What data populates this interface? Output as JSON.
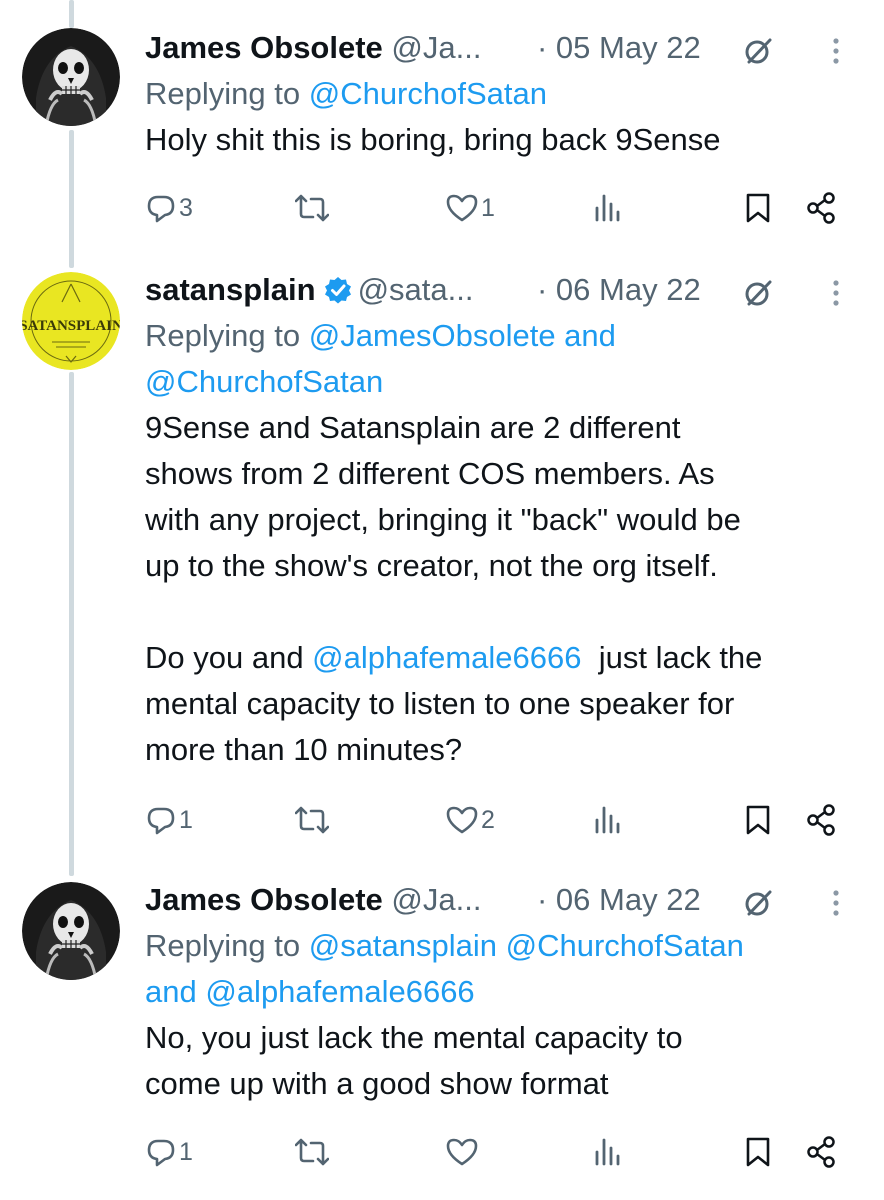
{
  "tweets": [
    {
      "name": "James Obsolete",
      "handle": "@Ja...",
      "date": "· 05 May 22",
      "reply_prefix": "Replying to ",
      "reply_links": [
        "@ChurchofSatan"
      ],
      "text": "Holy shit this is boring, bring back 9Sense",
      "replies": "3",
      "retweets": "",
      "likes": "1",
      "avatar": "skull-avatar"
    },
    {
      "name": "satansplain",
      "handle": "@sata...",
      "date": "· 06 May 22",
      "verified": true,
      "reply_prefix": "Replying to ",
      "reply_line1": "@JamesObsolete and",
      "reply_line2": "@ChurchofSatan",
      "text_p1": "9Sense and Satansplain are 2 different\nshows from 2 different COS members. As\nwith any project, bringing it \"back\" would be\nup to the show's creator, not the org itself.",
      "text_p2_a": "Do you and ",
      "text_p2_mention": "@alphafemale6666",
      "text_p2_b": "  just lack the",
      "text_p2_rest": "mental capacity to listen to one speaker for\nmore than 10 minutes?",
      "replies": "1",
      "retweets": "",
      "likes": "2",
      "avatar": "satansplain-logo",
      "avatar_text": "SATANSPLAIN"
    },
    {
      "name": "James Obsolete",
      "handle": "@Ja...",
      "date": "· 06 May 22",
      "reply_prefix": "Replying to ",
      "reply_line1": "@satansplain @ChurchofSatan",
      "reply_line2_a": "and ",
      "reply_line2_b": "@alphafemale6666",
      "text": "No, you just lack the mental capacity to\ncome up with a good show format",
      "replies": "1",
      "retweets": "",
      "likes": "",
      "avatar": "skull-avatar"
    }
  ],
  "colors": {
    "link": "#1d9bf0",
    "muted": "#536471",
    "thread": "#cfd9de",
    "verified": "#1d9bf0"
  }
}
